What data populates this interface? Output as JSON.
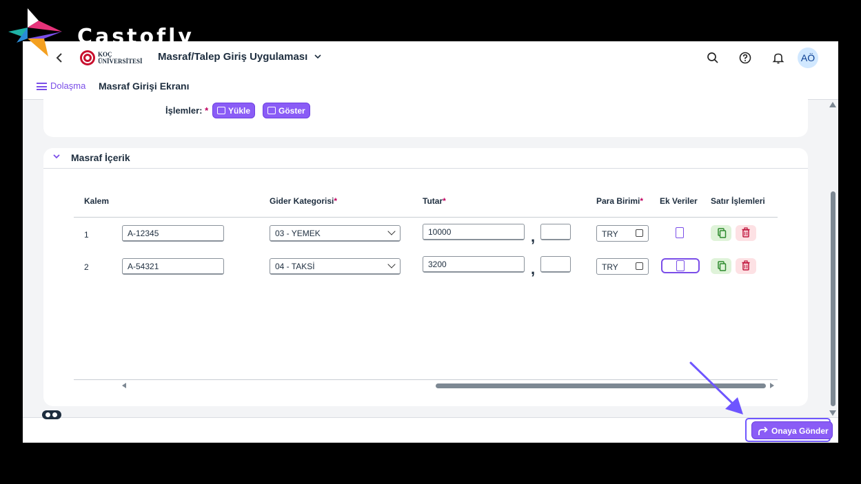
{
  "watermark": {
    "text": "Castofly"
  },
  "shellbar": {
    "logo_line1": "KOÇ",
    "logo_line2": "ÜNİVERSİTESİ",
    "app_title": "Masraf/Talep Giriş Uygulaması",
    "avatar_initials": "AÖ"
  },
  "subbar": {
    "nav_label": "Dolaşma",
    "page_title": "Masraf Girişi Ekranı"
  },
  "operations": {
    "label": "İşlemler:",
    "required_mark": "*",
    "upload_label": "Yükle",
    "show_label": "Göster"
  },
  "section": {
    "title": "Masraf İçerik"
  },
  "table": {
    "headers": {
      "kalem": "Kalem",
      "gider": "Gider Kategorisi",
      "tutar": "Tutar",
      "para": "Para Birimi",
      "ek": "Ek Veriler",
      "satir": "Satır İşlemleri"
    },
    "rows": [
      {
        "index": "1",
        "code": "A-12345",
        "category": "03 - YEMEK",
        "amount": "10000",
        "decimal": "",
        "currency": "TRY"
      },
      {
        "index": "2",
        "code": "A-54321",
        "category": "04 - TAKSİ",
        "amount": "3200",
        "decimal": "",
        "currency": "TRY"
      }
    ]
  },
  "footer": {
    "submit_label": "Onaya Gönder"
  },
  "colors": {
    "accent": "#8a5cf6",
    "required": "#c0005f",
    "pointer": "#6e55ff"
  }
}
